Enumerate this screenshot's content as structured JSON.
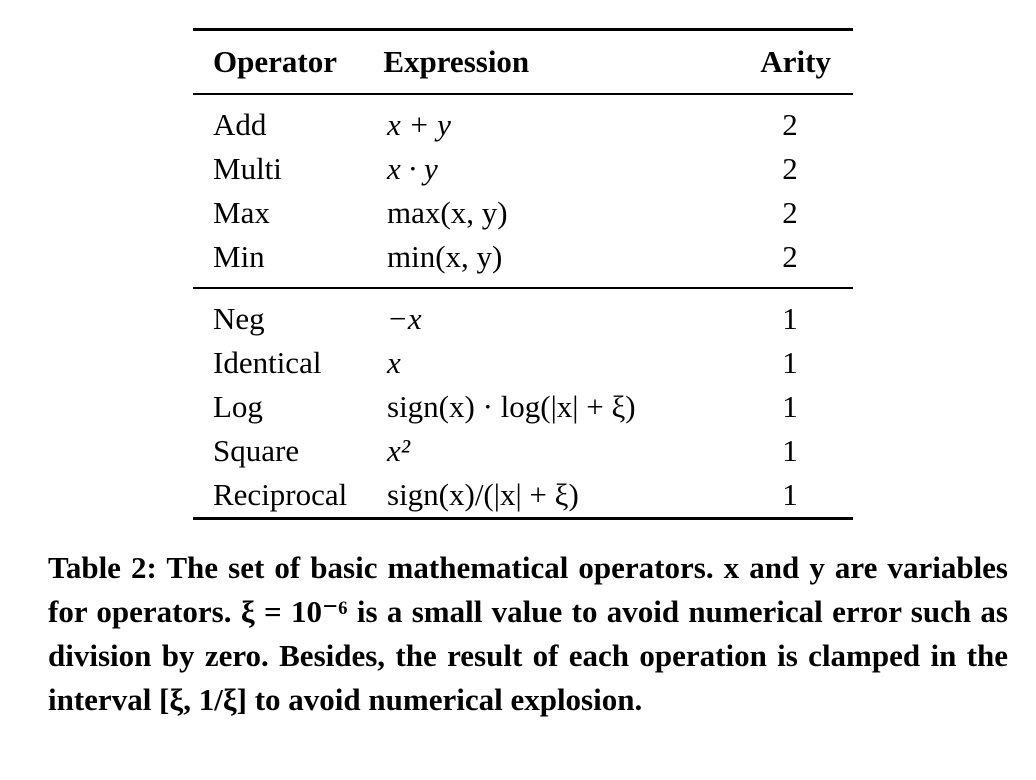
{
  "table": {
    "headers": [
      "Operator",
      "Expression",
      "Arity"
    ],
    "binary_rows": [
      {
        "operator": "Add",
        "expression": "x + y",
        "arity": "2"
      },
      {
        "operator": "Multi",
        "expression": "x · y",
        "arity": "2"
      },
      {
        "operator": "Max",
        "expression": "max(x, y)",
        "arity": "2"
      },
      {
        "operator": "Min",
        "expression": "min(x, y)",
        "arity": "2"
      }
    ],
    "unary_rows": [
      {
        "operator": "Neg",
        "expression": "−x",
        "arity": "1"
      },
      {
        "operator": "Identical",
        "expression": "x",
        "arity": "1"
      },
      {
        "operator": "Log",
        "expression": "sign(x) · log(|x| + ξ)",
        "arity": "1"
      },
      {
        "operator": "Square",
        "expression": "x²",
        "arity": "1"
      },
      {
        "operator": "Reciprocal",
        "expression": "sign(x)/(|x| + ξ)",
        "arity": "1"
      }
    ]
  },
  "caption": {
    "text": "Table 2: The set of basic mathematical operators. x and y are variables for operators. ξ = 10⁻⁶ is a small value to avoid numerical error such as division by zero. Besides, the result of each operation is clamped in the interval [ξ, 1/ξ] to avoid numerical explosion."
  }
}
